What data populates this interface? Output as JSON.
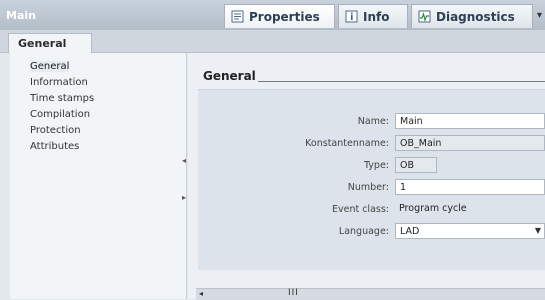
{
  "window": {
    "title": "Main"
  },
  "top_tabs": [
    {
      "label": "Properties",
      "icon": "properties-icon",
      "active": true
    },
    {
      "label": "Info",
      "icon": "info-icon",
      "active": false
    },
    {
      "label": "Diagnostics",
      "icon": "diagnostics-icon",
      "active": false
    }
  ],
  "sub_tab": {
    "label": "General"
  },
  "sidebar": {
    "items": [
      {
        "label": "General",
        "selected": true
      },
      {
        "label": "Information"
      },
      {
        "label": "Time stamps"
      },
      {
        "label": "Compilation"
      },
      {
        "label": "Protection"
      },
      {
        "label": "Attributes"
      }
    ]
  },
  "section": {
    "title": "General"
  },
  "form": {
    "name": {
      "label": "Name:",
      "value": "Main"
    },
    "constant_name": {
      "label": "Konstantenname:",
      "value": "OB_Main"
    },
    "type": {
      "label": "Type:",
      "value": "OB"
    },
    "number": {
      "label": "Number:",
      "value": "1"
    },
    "event_class": {
      "label": "Event class:",
      "value": "Program cycle"
    },
    "language": {
      "label": "Language:",
      "value": "LAD"
    }
  },
  "scrollbar": {
    "grip": "III"
  },
  "colors": {
    "accent": "#2b3f55",
    "panel": "#ecf0f4",
    "nav": "#f2f5f8",
    "titlebar": "#b3bdc8"
  }
}
